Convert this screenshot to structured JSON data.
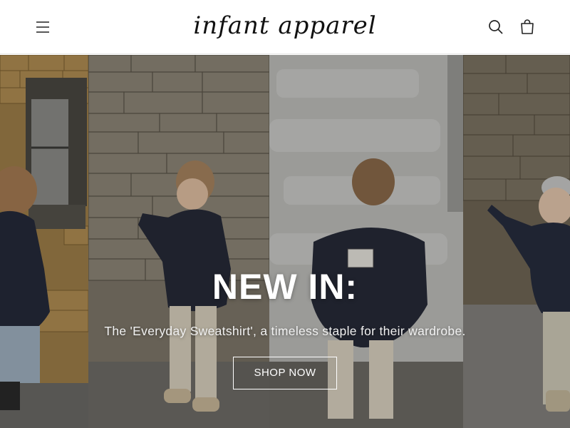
{
  "header": {
    "logo_text": "infant apparel",
    "menu_icon": "hamburger-menu-icon",
    "search_icon": "search-icon",
    "cart_icon": "shopping-bag-icon"
  },
  "hero": {
    "heading": "NEW IN:",
    "subheading": "The 'Everyday Sweatshirt', a timeless staple for their wardrobe.",
    "cta_label": "SHOP NOW"
  },
  "colors": {
    "text_primary": "#111111",
    "hero_text": "#ffffff",
    "header_bg": "#ffffff"
  }
}
